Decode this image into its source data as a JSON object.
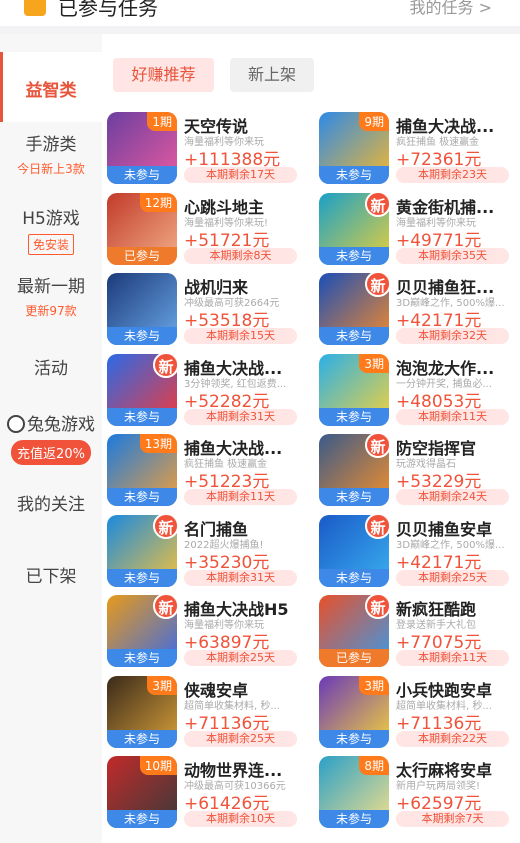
{
  "header": {
    "title": "已参与任务",
    "my_tasks": "我的任务 >"
  },
  "sidebar": {
    "items": [
      {
        "label": "益智类",
        "sub": ""
      },
      {
        "label": "手游类",
        "sub": "今日新上3款"
      },
      {
        "label": "H5游戏",
        "sub": "免安装"
      },
      {
        "label": "最新一期",
        "sub": "更新97款"
      },
      {
        "label": "活动",
        "sub": ""
      },
      {
        "label": "兔兔游戏",
        "sub": "充值返20%"
      },
      {
        "label": "我的关注",
        "sub": ""
      },
      {
        "label": "已下架",
        "sub": ""
      }
    ]
  },
  "tabs": {
    "recommend": "好赚推荐",
    "new": "新上架"
  },
  "games": [
    {
      "name": "天空传说",
      "desc": "海量福利等你来玩",
      "reward": "+111388元",
      "remain": "本期剩余17天",
      "badge": "1期",
      "status": "未参与",
      "c1": "#6b3fa0",
      "c2": "#e85aa0"
    },
    {
      "name": "捕鱼大决战...",
      "desc": "疯狂捕鱼 极速赢金",
      "reward": "+72361元",
      "remain": "本期剩余23天",
      "badge": "9期",
      "status": "未参与",
      "c1": "#2d8ae8",
      "c2": "#f5b82c"
    },
    {
      "name": "心跳斗地主",
      "desc": "海量福利等你来玩!",
      "reward": "+51721元",
      "remain": "本期剩余8天",
      "badge": "12期",
      "status": "已参与",
      "c1": "#c23a2a",
      "c2": "#f2b08a"
    },
    {
      "name": "黄金街机捕...",
      "desc": "海量福利等你来玩",
      "reward": "+49771元",
      "remain": "本期剩余35天",
      "badge": "新",
      "status": "未参与",
      "c1": "#1aa0c8",
      "c2": "#e8d03a"
    },
    {
      "name": "战机归来",
      "desc": "冲级最高可获2664元",
      "reward": "+53518元",
      "remain": "本期剩余15天",
      "badge": "",
      "status": "未参与",
      "c1": "#1c3a7a",
      "c2": "#6aa8e8"
    },
    {
      "name": "贝贝捕鱼狂...",
      "desc": "3D巅峰之作, 500%爆...",
      "reward": "+42171元",
      "remain": "本期剩余32天",
      "badge": "新",
      "status": "未参与",
      "c1": "#1a4fb8",
      "c2": "#f58a2a"
    },
    {
      "name": "捕鱼大决战...",
      "desc": "3分钟领奖, 红包返费...",
      "reward": "+52282元",
      "remain": "本期剩余31天",
      "badge": "新",
      "status": "未参与",
      "c1": "#2a6ae8",
      "c2": "#f23a3a"
    },
    {
      "name": "泡泡龙大作...",
      "desc": "一分钟开奖, 捕鱼必...",
      "reward": "+48053元",
      "remain": "本期剩余11天",
      "badge": "3期",
      "status": "未参与",
      "c1": "#2ab0e8",
      "c2": "#f5d23a"
    },
    {
      "name": "捕鱼大决战...",
      "desc": "疯狂捕鱼 极速赢金",
      "reward": "+51223元",
      "remain": "本期剩余11天",
      "badge": "13期",
      "status": "未参与",
      "c1": "#1a7ae0",
      "c2": "#f2a03a"
    },
    {
      "name": "防空指挥官",
      "desc": "玩游戏得晶石",
      "reward": "+53229元",
      "remain": "本期剩余24天",
      "badge": "新",
      "status": "未参与",
      "c1": "#3a5a8a",
      "c2": "#f5902a"
    },
    {
      "name": "名门捕鱼",
      "desc": "2022超火爆捕鱼!",
      "reward": "+35230元",
      "remain": "本期剩余31天",
      "badge": "新",
      "status": "未参与",
      "c1": "#1a8ae0",
      "c2": "#f5c23a"
    },
    {
      "name": "贝贝捕鱼安卓",
      "desc": "3D巅峰之作, 500%爆...",
      "reward": "+42171元",
      "remain": "本期剩余25天",
      "badge": "新",
      "status": "未参与",
      "c1": "#1a5ac8",
      "c2": "#3ab0f0"
    },
    {
      "name": "捕鱼大决战H5",
      "desc": "海量福利等你来玩",
      "reward": "+63897元",
      "remain": "本期剩余25天",
      "badge": "新",
      "status": "未参与",
      "c1": "#e89a1a",
      "c2": "#3a6ae8"
    },
    {
      "name": "新疯狂酷跑",
      "desc": "登录送新手大礼包",
      "reward": "+77075元",
      "remain": "本期剩余11天",
      "badge": "新",
      "status": "已参与",
      "c1": "#e8502a",
      "c2": "#3a9ae8"
    },
    {
      "name": "侠魂安卓",
      "desc": "超简单收集材料, 秒...",
      "reward": "+71136元",
      "remain": "本期剩余25天",
      "badge": "3期",
      "status": "未参与",
      "c1": "#3a2a1a",
      "c2": "#d8a03a"
    },
    {
      "name": "小兵快跑安卓",
      "desc": "超简单收集材料, 秒...",
      "reward": "+71136元",
      "remain": "本期剩余22天",
      "badge": "3期",
      "status": "未参与",
      "c1": "#6a3ab8",
      "c2": "#f5d23a"
    },
    {
      "name": "动物世界连...",
      "desc": "冲级最高可获10366元",
      "reward": "+61426元",
      "remain": "本期剩余10天",
      "badge": "10期",
      "status": "未参与",
      "c1": "#c22a2a",
      "c2": "#3a3a3a"
    },
    {
      "name": "太行麻将安卓",
      "desc": "新用户玩两局领奖!",
      "reward": "+62597元",
      "remain": "本期剩余7天",
      "badge": "8期",
      "status": "未参与",
      "c1": "#2aa0c8",
      "c2": "#f5e08a"
    }
  ]
}
